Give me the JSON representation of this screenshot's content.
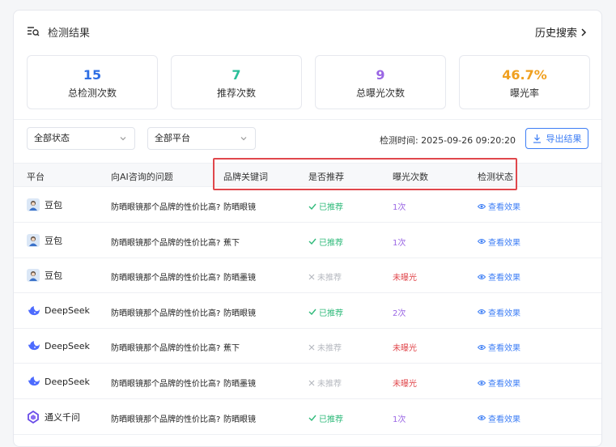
{
  "header": {
    "title": "检测结果",
    "history_link": "历史搜索"
  },
  "stats": [
    {
      "value": "15",
      "label": "总检测次数",
      "color": "#2f6fe4"
    },
    {
      "value": "7",
      "label": "推荐次数",
      "color": "#2bbf9a"
    },
    {
      "value": "9",
      "label": "总曝光次数",
      "color": "#9a66e4"
    },
    {
      "value": "46.7%",
      "label": "曝光率",
      "color": "#f0a020"
    }
  ],
  "filters": {
    "status": "全部状态",
    "platform": "全部平台"
  },
  "detect_time": "检测时间: 2025-09-26 09:20:20",
  "export_label": "导出结果",
  "columns": [
    "平台",
    "向AI咨询的问题",
    "品牌关键词",
    "是否推荐",
    "曝光次数",
    "检测状态"
  ],
  "rows": [
    {
      "platform": "豆包",
      "icon": "doubao-avatar-icon",
      "question": "防晒眼镜那个品牌的性价比高?",
      "keyword": "防晒眼镜",
      "recommend": "已推荐",
      "rec_ok": true,
      "exposure": "1次",
      "exp_ok": true,
      "status": "查看效果"
    },
    {
      "platform": "豆包",
      "icon": "doubao-avatar-icon",
      "question": "防晒眼镜那个品牌的性价比高?",
      "keyword": "蕉下",
      "recommend": "已推荐",
      "rec_ok": true,
      "exposure": "1次",
      "exp_ok": true,
      "status": "查看效果"
    },
    {
      "platform": "豆包",
      "icon": "doubao-avatar-icon",
      "question": "防晒眼镜那个品牌的性价比高?",
      "keyword": "防晒墨镜",
      "recommend": "未推荐",
      "rec_ok": false,
      "exposure": "未曝光",
      "exp_ok": false,
      "status": "查看效果"
    },
    {
      "platform": "DeepSeek",
      "icon": "deepseek-whale-icon",
      "question": "防晒眼镜那个品牌的性价比高?",
      "keyword": "防晒眼镜",
      "recommend": "已推荐",
      "rec_ok": true,
      "exposure": "2次",
      "exp_ok": true,
      "status": "查看效果"
    },
    {
      "platform": "DeepSeek",
      "icon": "deepseek-whale-icon",
      "question": "防晒眼镜那个品牌的性价比高?",
      "keyword": "蕉下",
      "recommend": "未推荐",
      "rec_ok": false,
      "exposure": "未曝光",
      "exp_ok": false,
      "status": "查看效果"
    },
    {
      "platform": "DeepSeek",
      "icon": "deepseek-whale-icon",
      "question": "防晒眼镜那个品牌的性价比高?",
      "keyword": "防晒墨镜",
      "recommend": "未推荐",
      "rec_ok": false,
      "exposure": "未曝光",
      "exp_ok": false,
      "status": "查看效果"
    },
    {
      "platform": "通义千问",
      "icon": "tongyi-logo-icon",
      "question": "防晒眼镜那个品牌的性价比高?",
      "keyword": "防晒眼镜",
      "recommend": "已推荐",
      "rec_ok": true,
      "exposure": "1次",
      "exp_ok": true,
      "status": "查看效果"
    }
  ]
}
